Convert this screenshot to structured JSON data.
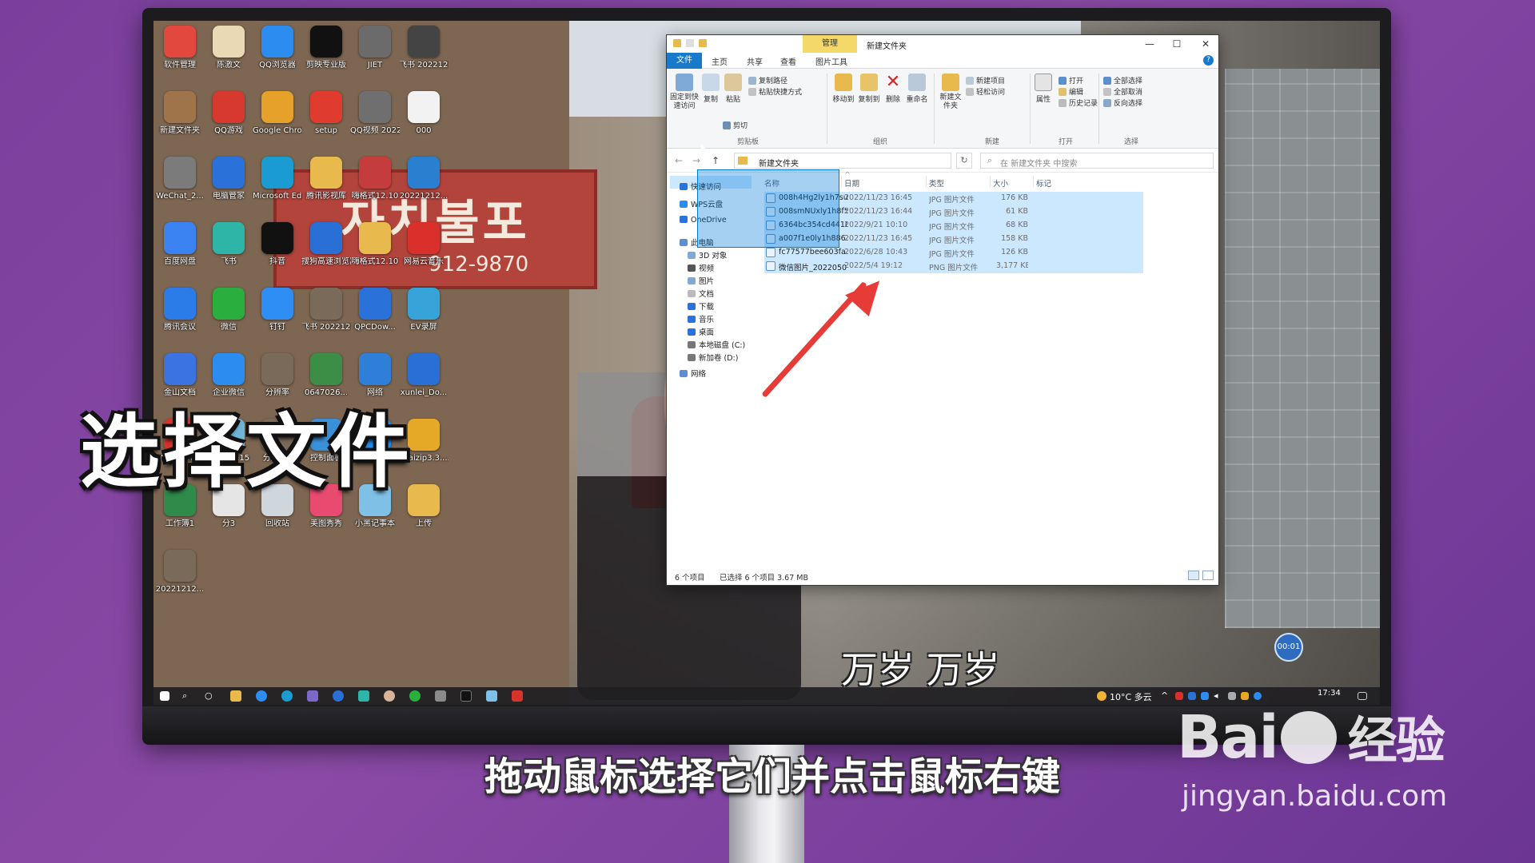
{
  "desktop": {
    "icons": [
      {
        "label": "软件管理",
        "color": "#e3483f"
      },
      {
        "label": "陈激文",
        "color": "#e9d9b5"
      },
      {
        "label": "QQ浏览器",
        "color": "#2d8cf0"
      },
      {
        "label": "剪映专业版",
        "color": "#111111"
      },
      {
        "label": "JIET",
        "color": "#6b6b6b"
      },
      {
        "label": "飞书 20221212...",
        "color": "#444444"
      },
      {
        "label": "新建文件夹",
        "color": "#a0744a"
      },
      {
        "label": "QQ游戏",
        "color": "#d7392f"
      },
      {
        "label": "Google Chrome",
        "color": "#e5a12a"
      },
      {
        "label": "setup",
        "color": "#e03b2f"
      },
      {
        "label": "QQ视频 20221212...",
        "color": "#6f6f6f"
      },
      {
        "label": "000",
        "color": "#f2f2f2"
      },
      {
        "label": "WeChat_2...",
        "color": "#7b7b7b"
      },
      {
        "label": "电脑管家",
        "color": "#2a72d9"
      },
      {
        "label": "Microsoft Edge",
        "color": "#1a9bd1"
      },
      {
        "label": "腾讯影视库",
        "color": "#e8b94c"
      },
      {
        "label": "嗨格式12.10",
        "color": "#c53c3c"
      },
      {
        "label": "20221212...",
        "color": "#2a7fd1"
      },
      {
        "label": "百度网盘",
        "color": "#3a83f0"
      },
      {
        "label": "飞书",
        "color": "#2fb5a7"
      },
      {
        "label": "抖音",
        "color": "#111111"
      },
      {
        "label": "搜狗高速浏览器",
        "color": "#2a6fd6"
      },
      {
        "label": "嗨格式12.10",
        "color": "#e8b94c"
      },
      {
        "label": "网易云音乐",
        "color": "#d9302b"
      },
      {
        "label": "腾讯会议",
        "color": "#2b7ce9"
      },
      {
        "label": "微信",
        "color": "#2aae3e"
      },
      {
        "label": "钉钉",
        "color": "#2f8ef3"
      },
      {
        "label": "飞书 20221212...",
        "color": "#7a6a5a"
      },
      {
        "label": "QPCDow...",
        "color": "#2a72d9"
      },
      {
        "label": "EV录屏",
        "color": "#36a3d9"
      },
      {
        "label": "金山文档",
        "color": "#3b74e2"
      },
      {
        "label": "企业微信",
        "color": "#2d8cf0"
      },
      {
        "label": "分辨率",
        "color": "#7a6a5a"
      },
      {
        "label": "0647026...",
        "color": "#3c8d46"
      },
      {
        "label": "网络",
        "color": "#2f7fd8"
      },
      {
        "label": "xunlei_Do...",
        "color": "#2a6fd6"
      },
      {
        "label": "WPS Office",
        "color": "#d8322c"
      },
      {
        "label": "工具箱8.15",
        "color": "#6fb6d6"
      },
      {
        "label": "分辨率2",
        "color": "#7a6a5a"
      },
      {
        "label": "控制面板",
        "color": "#3a90d8"
      },
      {
        "label": "酷狗音乐",
        "color": "#1f8ef2"
      },
      {
        "label": "kuaizip3.3....",
        "color": "#e6a827"
      },
      {
        "label": "工作簿1",
        "color": "#2e8b4a"
      },
      {
        "label": "分3",
        "color": "#e5e5e5"
      },
      {
        "label": "回收站",
        "color": "#cfd6dc"
      },
      {
        "label": "美图秀秀",
        "color": "#e84a70"
      },
      {
        "label": "小黑记事本",
        "color": "#7fc1e6"
      },
      {
        "label": "上传",
        "color": "#e8b94c"
      },
      {
        "label": "20221212...",
        "color": "#7a6a5a"
      }
    ],
    "bg_sign_text": "자치불포",
    "bg_sign_number": "912-9870"
  },
  "explorer": {
    "window_title": "新建文件夹",
    "contextual_tab": "管理",
    "tabs": [
      "文件",
      "主页",
      "共享",
      "查看",
      "图片工具"
    ],
    "ribbon": {
      "clipboard": {
        "label": "剪贴板",
        "pin": "固定到快速访问",
        "copy": "复制",
        "paste": "粘贴",
        "copy_path": "复制路径",
        "paste_shortcut": "粘贴快捷方式",
        "cut": "剪切"
      },
      "organize": {
        "label": "组织",
        "move_to": "移动到",
        "copy_to": "复制到",
        "delete": "删除",
        "rename": "重命名"
      },
      "new": {
        "label": "新建",
        "new_folder": "新建文件夹",
        "new_item": "新建项目",
        "easy_access": "轻松访问"
      },
      "open": {
        "label": "打开",
        "properties": "属性",
        "open": "打开",
        "edit": "编辑",
        "history": "历史记录"
      },
      "select": {
        "label": "选择",
        "select_all": "全部选择",
        "select_none": "全部取消",
        "invert": "反向选择"
      }
    },
    "address": "新建文件夹",
    "search_placeholder": "在 新建文件夹 中搜索",
    "nav": [
      "快速访问",
      "WPS云盘",
      "OneDrive",
      "此电脑",
      "3D 对象",
      "视频",
      "图片",
      "文档",
      "下载",
      "音乐",
      "桌面",
      "本地磁盘 (C:)",
      "新加卷 (D:)",
      "网络"
    ],
    "columns": [
      "名称",
      "日期",
      "类型",
      "大小",
      "标记"
    ],
    "files": [
      {
        "name": "008h4Hg2ly1h7su...",
        "date": "2022/11/23 16:45",
        "type": "JPG 图片文件",
        "size": "176 KB"
      },
      {
        "name": "008smNUxly1h8f5...",
        "date": "2022/11/23 16:44",
        "type": "JPG 图片文件",
        "size": "61 KB"
      },
      {
        "name": "6364bc354cd4410...",
        "date": "2022/9/21 10:10",
        "type": "JPG 图片文件",
        "size": "68 KB"
      },
      {
        "name": "a007f1e0ly1h886...",
        "date": "2022/11/23 16:45",
        "type": "JPG 图片文件",
        "size": "158 KB"
      },
      {
        "name": "fc77577bee603fa...",
        "date": "2022/6/28 10:43",
        "type": "JPG 图片文件",
        "size": "126 KB"
      },
      {
        "name": "微信图片_2022050...",
        "date": "2022/5/4 19:12",
        "type": "PNG 图片文件",
        "size": "3,177 KB"
      }
    ],
    "status": {
      "count": "6 个项目",
      "selected": "已选择 6 个项目  3.67 MB"
    }
  },
  "taskbar": {
    "weather": "10°C 多云",
    "time": "17:34"
  },
  "timer": "00:01",
  "overlay_title": "选择文件",
  "screen_subtitle": "万岁 万岁",
  "caption": "拖动鼠标选择它们并点击鼠标右键",
  "watermark": {
    "logo_left": "Bai",
    "logo_right": "经验",
    "url": "jingyan.baidu.com"
  }
}
